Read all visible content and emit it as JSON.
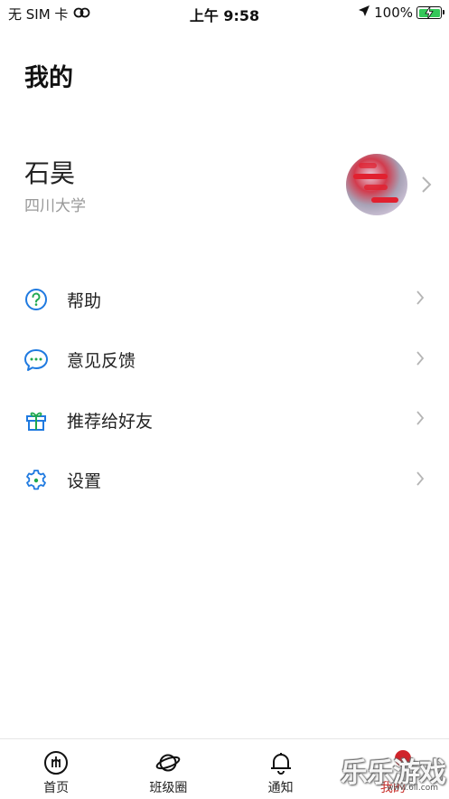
{
  "status_bar": {
    "carrier": "无 SIM 卡",
    "time": "上午 9:58",
    "battery": "100%",
    "icons": [
      "wifi-icon",
      "location-arrow-icon",
      "battery-charging-icon"
    ]
  },
  "header": {
    "title": "我的"
  },
  "profile": {
    "name": "石昊",
    "school": "四川大学",
    "avatar_icon": "avatar-photo"
  },
  "menu": {
    "items": [
      {
        "label": "帮助",
        "icon": "help-icon"
      },
      {
        "label": "意见反馈",
        "icon": "feedback-chat-icon"
      },
      {
        "label": "推荐给好友",
        "icon": "gift-icon"
      },
      {
        "label": "设置",
        "icon": "settings-gear-icon"
      }
    ]
  },
  "tabbar": {
    "tabs": [
      {
        "label": "首页",
        "icon": "home-icon"
      },
      {
        "label": "班级圈",
        "icon": "planet-icon"
      },
      {
        "label": "通知",
        "icon": "bell-icon"
      },
      {
        "label": "我的",
        "icon": "profile-icon"
      }
    ],
    "active_index": 3
  },
  "watermark": {
    "text": "乐乐游戏",
    "url": "www.6ll.com"
  },
  "colors": {
    "accent_blue": "#1f7ae0",
    "accent_green": "#1fa84f",
    "active_tab": "#c9302c",
    "secondary_text": "#999999"
  }
}
